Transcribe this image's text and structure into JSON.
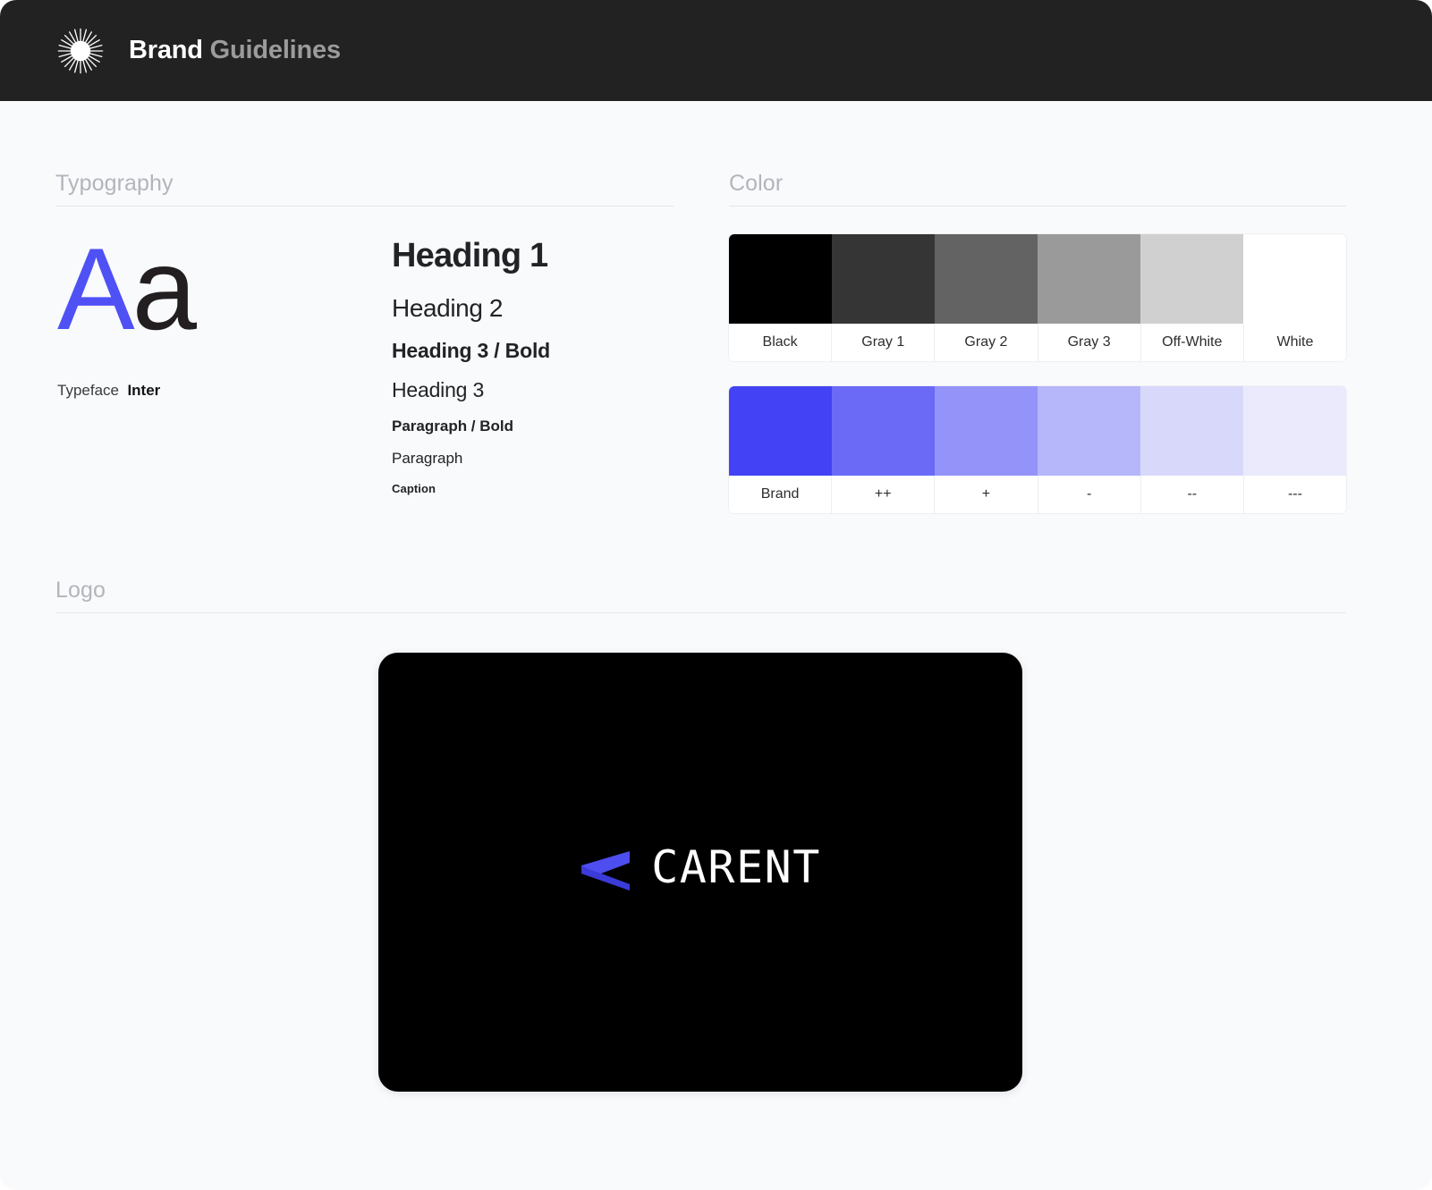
{
  "header": {
    "icon": "starburst-icon",
    "title_primary": "Brand",
    "title_secondary": "Guidelines",
    "background": "#222222"
  },
  "sections": {
    "typography": "Typography",
    "color": "Color",
    "logo": "Logo"
  },
  "typography": {
    "specimen_upper": "A",
    "specimen_lower": "a",
    "specimen_upper_color": "#4f51f5",
    "specimen_lower_color": "#231f20",
    "typeface_label": "Typeface",
    "typeface_value": "Inter",
    "scale": [
      {
        "label": "Heading 1"
      },
      {
        "label": "Heading 2"
      },
      {
        "label": "Heading 3 / Bold"
      },
      {
        "label": "Heading 3"
      },
      {
        "label": "Paragraph / Bold"
      },
      {
        "label": "Paragraph"
      },
      {
        "label": "Caption"
      }
    ]
  },
  "color": {
    "neutral": [
      {
        "label": "Black",
        "hex": "#000000"
      },
      {
        "label": "Gray 1",
        "hex": "#353535"
      },
      {
        "label": "Gray 2",
        "hex": "#636363"
      },
      {
        "label": "Gray 3",
        "hex": "#9a9a9a"
      },
      {
        "label": "Off-White",
        "hex": "#d0d0d0"
      },
      {
        "label": "White",
        "hex": "#ffffff"
      }
    ],
    "brand": [
      {
        "label": "Brand",
        "hex": "#4343f5"
      },
      {
        "label": "++",
        "hex": "#6a6af7"
      },
      {
        "label": "+",
        "hex": "#9393f9"
      },
      {
        "label": "-",
        "hex": "#b6b6fa"
      },
      {
        "label": "--",
        "hex": "#d8d8fb"
      },
      {
        "label": "---",
        "hex": "#eaeafc"
      }
    ]
  },
  "logo": {
    "wordmark": "CARENT",
    "mark": "chevron-left-icon",
    "mark_color": "#4d4df0",
    "card_background": "#000000",
    "wordmark_color": "#ffffff"
  }
}
